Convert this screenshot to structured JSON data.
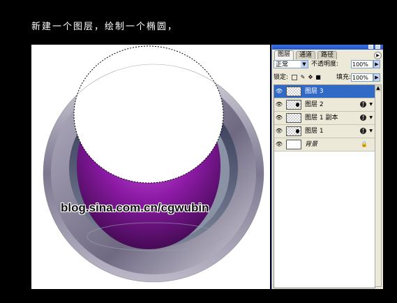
{
  "caption": "新建一个图层，绘制一个椭圆，",
  "canvas": {
    "watermark": "blog.sina.com.cn/cgwubin",
    "colors": {
      "ring": "#8a8598",
      "inner": "#4b4f72",
      "purple": "#8a1aa0"
    }
  },
  "panel": {
    "tabs": [
      "图层",
      "通道",
      "路径"
    ],
    "menu_icon": "panel-menu-icon",
    "blend_mode": "正常",
    "opacity_label": "不透明度:",
    "opacity_value": "100%",
    "lock_label": "锁定:",
    "fill_label": "填充:",
    "fill_value": "100%",
    "layers": [
      {
        "name": "图层 3",
        "selected": true,
        "thumb": "transparent",
        "effects": false
      },
      {
        "name": "图层 2",
        "selected": false,
        "thumb": "transparent-dot",
        "effects": true
      },
      {
        "name": "图层 1 副本",
        "selected": false,
        "thumb": "transparent",
        "effects": true
      },
      {
        "name": "图层 1",
        "selected": false,
        "thumb": "transparent-dot",
        "effects": true
      },
      {
        "name": "背景",
        "selected": false,
        "thumb": "white",
        "locked": true
      }
    ],
    "colors": {
      "selected": "#3169c6",
      "panel_bg": "#ece9d8",
      "titlebar": "#2a5fd4"
    }
  }
}
